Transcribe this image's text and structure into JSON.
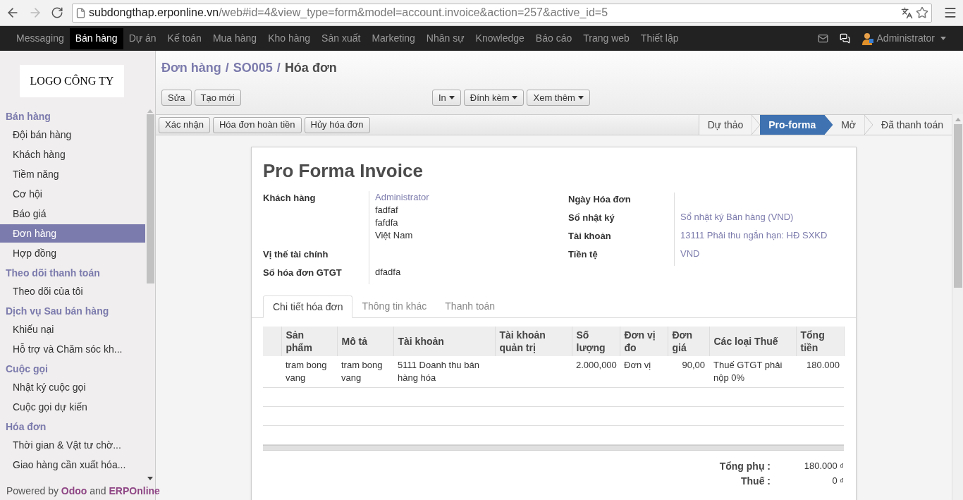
{
  "browser": {
    "url_host": "subdongthap.erponline.vn",
    "url_path": "/web#id=4&view_type=form&model=account.invoice&action=257&active_id=5"
  },
  "nav": {
    "items": [
      {
        "label": "Messaging",
        "selected": false
      },
      {
        "label": "Bán hàng",
        "selected": true
      },
      {
        "label": "Dự án",
        "selected": false
      },
      {
        "label": "Kế toán",
        "selected": false
      },
      {
        "label": "Mua hàng",
        "selected": false
      },
      {
        "label": "Kho hàng",
        "selected": false
      },
      {
        "label": "Sản xuất",
        "selected": false
      },
      {
        "label": "Marketing",
        "selected": false
      },
      {
        "label": "Nhân sự",
        "selected": false
      },
      {
        "label": "Knowledge",
        "selected": false
      },
      {
        "label": "Báo cáo",
        "selected": false
      },
      {
        "label": "Trang web",
        "selected": false
      },
      {
        "label": "Thiết lập",
        "selected": false
      }
    ],
    "user": "Administrator"
  },
  "sidebar": {
    "logo": "LOGO CÔNG TY",
    "groups": [
      {
        "title": "Bán hàng",
        "items": [
          {
            "label": "Đội bán hàng",
            "selected": false
          },
          {
            "label": "Khách hàng",
            "selected": false
          },
          {
            "label": "Tiềm năng",
            "selected": false
          },
          {
            "label": "Cơ hội",
            "selected": false
          },
          {
            "label": "Báo giá",
            "selected": false
          },
          {
            "label": "Đơn hàng",
            "selected": true
          },
          {
            "label": "Hợp đồng",
            "selected": false
          }
        ]
      },
      {
        "title": "Theo dõi thanh toán",
        "items": [
          {
            "label": "Theo dõi của tôi",
            "selected": false
          }
        ]
      },
      {
        "title": "Dịch vụ Sau bán hàng",
        "items": [
          {
            "label": "Khiếu nại",
            "selected": false
          },
          {
            "label": "Hỗ trợ và Chăm sóc kh...",
            "selected": false
          }
        ]
      },
      {
        "title": "Cuộc gọi",
        "items": [
          {
            "label": "Nhật ký cuộc gọi",
            "selected": false
          },
          {
            "label": "Cuộc gọi dự kiến",
            "selected": false
          }
        ]
      },
      {
        "title": "Hóa đơn",
        "items": [
          {
            "label": "Thời gian & Vật tư chờ...",
            "selected": false
          },
          {
            "label": "Giao hàng cần xuất hóa...",
            "selected": false
          }
        ]
      }
    ],
    "footer": {
      "prefix": "Powered by",
      "link1": "Odoo",
      "middle": "and",
      "link2": "ERPOnline"
    }
  },
  "breadcrumb": [
    {
      "label": "Đơn hàng",
      "current": false
    },
    {
      "label": "SO005",
      "current": false
    },
    {
      "label": "Hóa đơn",
      "current": true
    }
  ],
  "breadcrumb_separators": [
    "/",
    "/"
  ],
  "toolbar": {
    "buttons": [
      "Sửa",
      "Tạo mới"
    ],
    "dropdowns": [
      "In",
      "Đính kèm",
      "Xem thêm"
    ]
  },
  "actions": [
    "Xác nhận",
    "Hóa đơn hoàn tiền",
    "Hủy hóa đơn"
  ],
  "statuses": [
    {
      "label": "Dự thảo",
      "selected": false
    },
    {
      "label": "Pro-forma",
      "selected": true
    },
    {
      "label": "Mở",
      "selected": false
    },
    {
      "label": "Đã thanh toán",
      "selected": false
    }
  ],
  "form": {
    "title": "Pro Forma Invoice",
    "left_fields": [
      {
        "label": "Khách hàng",
        "values": [
          {
            "text": "Administrator",
            "link": true
          },
          {
            "text": "fadfaf",
            "link": false
          },
          {
            "text": "fafdfa",
            "link": false
          },
          {
            "text": "Việt Nam",
            "link": false
          }
        ]
      },
      {
        "label": "Vị thế tài chính"
      },
      {
        "label": "Số hóa đơn GTGT",
        "values": [
          {
            "text": "dfadfa",
            "link": false
          }
        ]
      }
    ],
    "right_fields": [
      {
        "label": "Ngày Hóa đơn"
      },
      {
        "label": "Sổ nhật ký",
        "values": [
          {
            "text": "Sổ nhật ký Bán hàng (VND)",
            "link": true
          }
        ]
      },
      {
        "label": "Tài khoản",
        "values": [
          {
            "text": "13111 Phải thu ngắn hạn: HĐ SXKD",
            "link": true
          }
        ]
      },
      {
        "label": "Tiền tệ",
        "values": [
          {
            "text": "VND",
            "link": true
          }
        ]
      }
    ],
    "tabs": [
      {
        "label": "Chi tiết hóa đơn",
        "selected": true
      },
      {
        "label": "Thông tin khác",
        "selected": false
      },
      {
        "label": "Thanh toán",
        "selected": false
      }
    ],
    "table": {
      "columns": [
        "Sản phẩm",
        "Mô tả",
        "Tài khoản",
        "Tài khoản quản trị",
        "Số lượng",
        "Đơn vị đo",
        "Đơn giá",
        "Các loại Thuế",
        "Tổng tiền"
      ],
      "rows": [
        [
          "tram bong vang",
          "tram bong vang",
          "5111 Doanh thu bán hàng hóa",
          "",
          "2.000,000",
          "Đơn vị",
          "90,00",
          "Thuế GTGT phải nộp 0%",
          "180.000"
        ]
      ]
    },
    "totals": [
      {
        "label": "Tổng phụ :",
        "value": "180.000",
        "currency": "₫"
      },
      {
        "label": "Thuế :",
        "value": "0",
        "currency": "₫"
      }
    ]
  }
}
